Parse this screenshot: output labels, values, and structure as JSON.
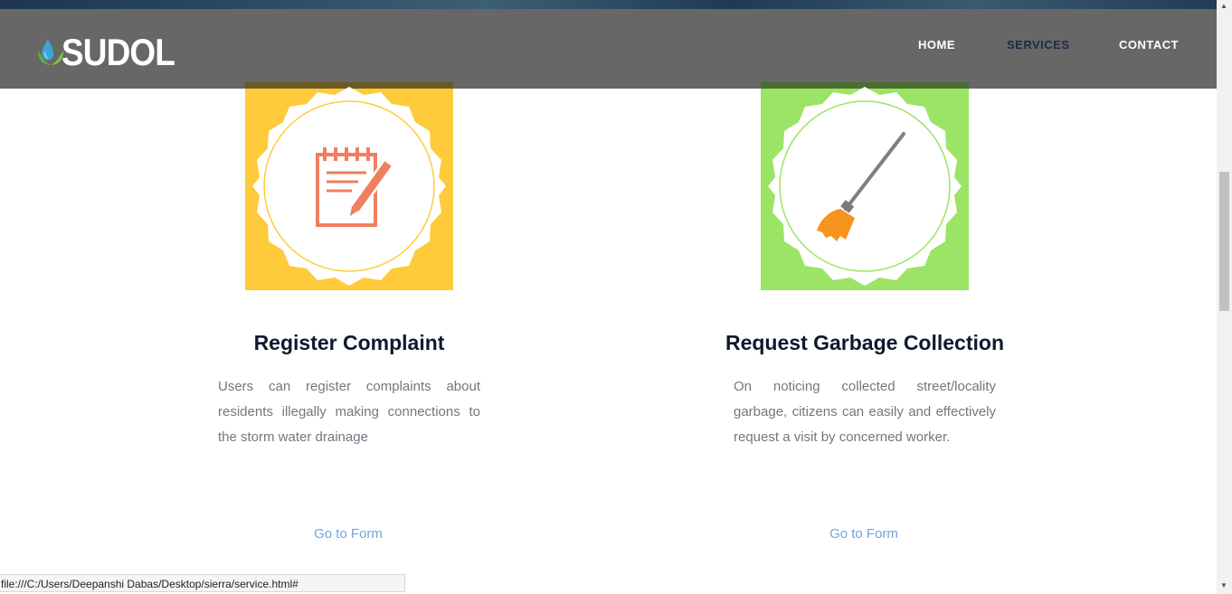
{
  "header": {
    "logo_text": "SUDOL",
    "nav": [
      {
        "label": "HOME",
        "active": false
      },
      {
        "label": "SERVICES",
        "active": true
      },
      {
        "label": "CONTACT",
        "active": false
      }
    ]
  },
  "services": [
    {
      "icon": "notepad-pencil-icon",
      "bg_color": "#ffcb3a",
      "title": "Register Complaint",
      "description": "Users can register complaints about residents illegally making connections to the storm water drainage",
      "link": "Go to Form"
    },
    {
      "icon": "broom-icon",
      "bg_color": "#9be465",
      "title": "Request Garbage Collection",
      "description": "On noticing collected street/locality garbage, citizens can easily and effectively request a visit by concerned worker.",
      "link": "Go to Form"
    }
  ],
  "status_bar": {
    "url": "file:///C:/Users/Deepanshi Dabas/Desktop/sierra/service.html#"
  },
  "colors": {
    "navbar": "#676767",
    "accent_active": "#1e2a48",
    "link": "#6fa6dc",
    "title": "#0f1830",
    "body_text": "#707880"
  }
}
